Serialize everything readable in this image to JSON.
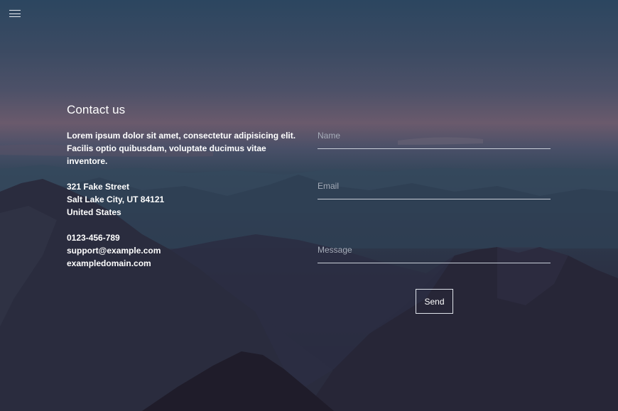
{
  "nav": {
    "menu_icon": "hamburger-menu-icon"
  },
  "contact": {
    "title": "Contact us",
    "intro_lines": [
      "Lorem ipsum dolor sit amet, consectetur adipisicing elit.",
      "Facilis optio quibusdam, voluptate ducimus vitae inventore."
    ],
    "address_lines": [
      "321 Fake Street",
      "Salt Lake City, UT 84121",
      "United States"
    ],
    "phone": "0123-456-789",
    "email": "support@example.com",
    "website": "exampledomain.com"
  },
  "form": {
    "name_placeholder": "Name",
    "email_placeholder": "Email",
    "message_placeholder": "Message",
    "send_label": "Send"
  }
}
